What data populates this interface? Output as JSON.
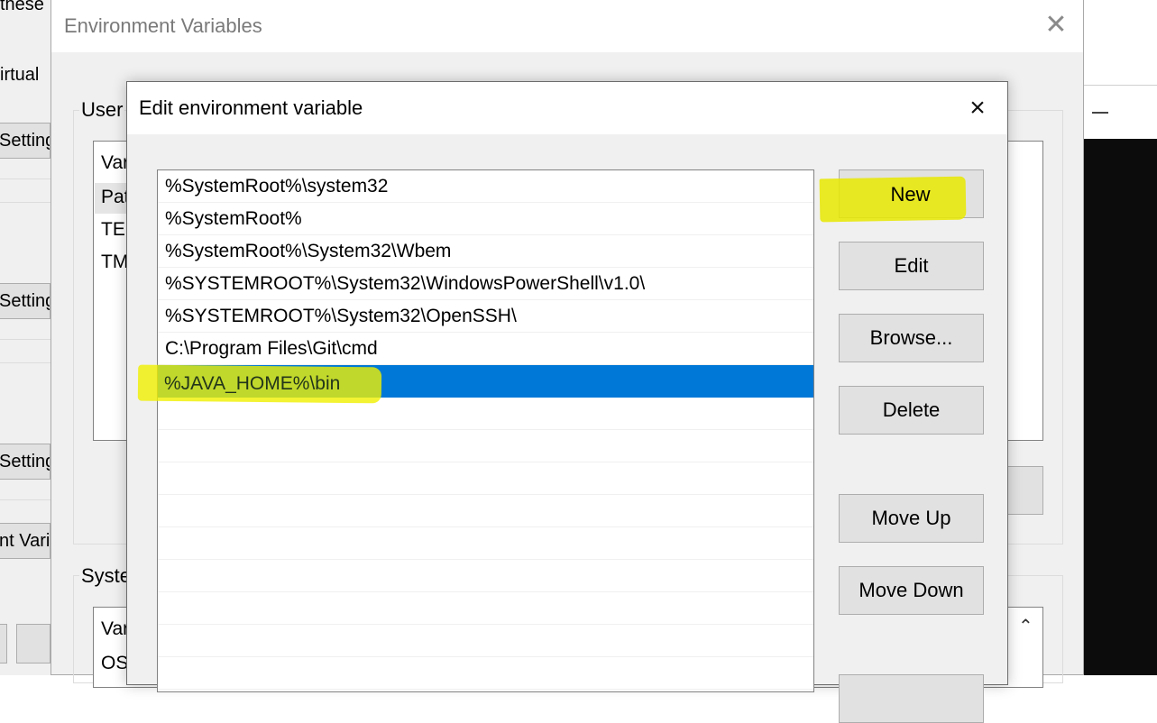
{
  "background_window": {
    "texts": [
      "these",
      "irtual"
    ],
    "settings_buttons": [
      "Setting",
      "Setting",
      "Setting"
    ],
    "env_vars_button": "nt Vari"
  },
  "env_dialog": {
    "title": "Environment Variables",
    "close_icon": "close-icon",
    "user_group_label": "User",
    "user_list": [
      "Var",
      "Pat",
      "TEI",
      "TM"
    ],
    "system_group_label": "Syste",
    "system_list": [
      "Var",
      "OS"
    ],
    "scroll_up_glyph": "^"
  },
  "edit_dialog": {
    "title": "Edit environment variable",
    "close_glyph": "×",
    "paths": [
      "%SystemRoot%\\system32",
      "%SystemRoot%",
      "%SystemRoot%\\System32\\Wbem",
      "%SYSTEMROOT%\\System32\\WindowsPowerShell\\v1.0\\",
      "%SYSTEMROOT%\\System32\\OpenSSH\\",
      "C:\\Program Files\\Git\\cmd",
      "%JAVA_HOME%\\bin"
    ],
    "selected_index": 6,
    "buttons": {
      "new": "New",
      "edit": "Edit",
      "browse": "Browse...",
      "delete": "Delete",
      "move_up": "Move Up",
      "move_down": "Move Down"
    },
    "highlight_color": "#f0f000",
    "selection_color": "#0078d7"
  }
}
